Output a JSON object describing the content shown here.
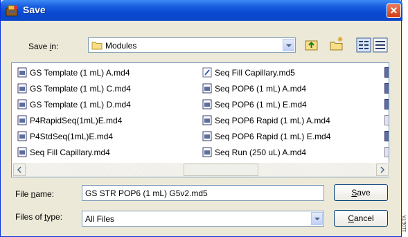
{
  "window": {
    "title": "Save",
    "close_label": "✕"
  },
  "toolbar": {
    "save_in_label_pre": "Save ",
    "save_in_label_accel": "i",
    "save_in_label_post": "n:",
    "location": "Modules",
    "icons": [
      "up-one-level-icon",
      "new-folder-icon",
      "list-view-icon",
      "details-view-icon"
    ]
  },
  "files": {
    "column1": [
      "GS Template (1 mL) A.md4",
      "GS Template (1 mL) C.md4",
      "GS Template (1 mL) D.md4",
      "P4RapidSeq(1mL)E.md4",
      "P4StdSeq(1mL)E.md4",
      "Seq Fill Capillary.md4"
    ],
    "column2": [
      "Seq Fill Capillary.md5",
      "Seq POP6 (1 mL) A.md4",
      "Seq POP6 (1 mL) E.md4",
      "Seq POP6 Rapid (1 mL) A.md4",
      "Seq POP6 Rapid (1 mL) E.md4",
      "Seq Run (250 uL) A.md4"
    ]
  },
  "form": {
    "filename_label_pre": "File ",
    "filename_label_accel": "n",
    "filename_label_post": "ame:",
    "filename_value": "GS STR POP6 (1 mL) G5v2.md5",
    "filetype_label_pre": "Files of ",
    "filetype_label_accel": "t",
    "filetype_label_post": "ype:",
    "filetype_value": "All Files"
  },
  "buttons": {
    "save_accel": "S",
    "save_rest": "ave",
    "cancel_accel": "C",
    "cancel_rest": "ancel"
  },
  "side_mark": "110ETA"
}
